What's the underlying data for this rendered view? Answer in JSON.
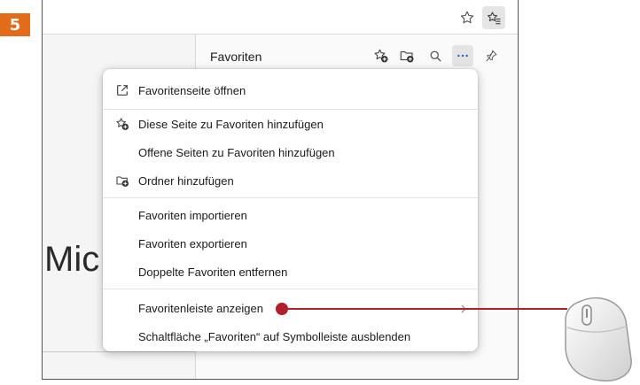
{
  "step": {
    "number": "5",
    "color": "#e36c1a"
  },
  "browser": {
    "toolbar_icons": [
      "star-outline-icon",
      "favorites-hub-icon"
    ],
    "page_text": "Mic"
  },
  "favorites_panel": {
    "title": "Favoriten",
    "header_icons": [
      "add-favorite-icon",
      "add-folder-icon",
      "search-icon",
      "more-options-icon",
      "pin-icon"
    ]
  },
  "menu": {
    "items": [
      {
        "label": "Favoritenseite öffnen",
        "icon": "open-external-icon"
      },
      {
        "label": "Diese Seite zu Favoriten hinzufügen",
        "icon": "add-favorite-icon"
      },
      {
        "label": "Offene Seiten zu Favoriten hinzufügen",
        "icon": ""
      },
      {
        "label": "Ordner hinzufügen",
        "icon": "add-folder-icon"
      },
      {
        "label": "Favoriten importieren",
        "icon": ""
      },
      {
        "label": "Favoriten exportieren",
        "icon": ""
      },
      {
        "label": "Doppelte Favoriten entfernen",
        "icon": ""
      },
      {
        "label": "Favoritenleiste anzeigen",
        "icon": "",
        "submenu": true
      },
      {
        "label": "Schaltfläche „Favoriten“ auf Symbolleiste ausblenden",
        "icon": ""
      }
    ]
  },
  "annotation": {
    "color": "#b11f2b",
    "target": "Favoritenleiste anzeigen"
  }
}
